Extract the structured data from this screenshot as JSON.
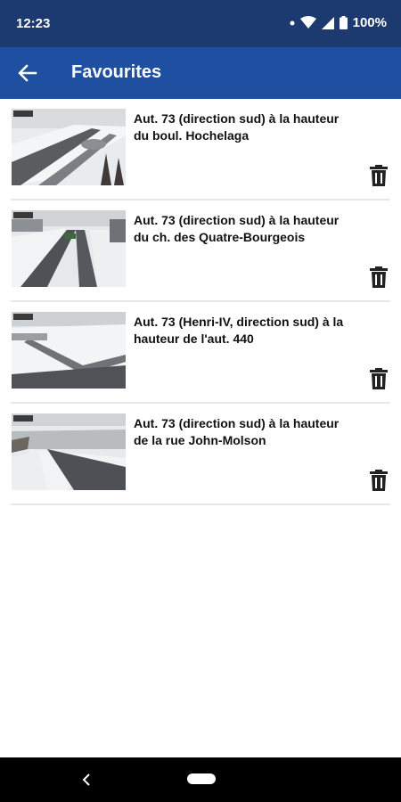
{
  "status": {
    "time": "12:23",
    "battery": "100%",
    "icons": [
      "dot-icon",
      "wifi-icon",
      "signal-icon",
      "battery-icon"
    ]
  },
  "app_bar": {
    "title": "Favourites",
    "back_icon": "arrow-left-icon"
  },
  "favourites": [
    {
      "title": "Aut. 73 (direction sud) à la hauteur du boul. Hochelaga",
      "action_icon": "trash-icon"
    },
    {
      "title": "Aut. 73 (direction sud) à la hauteur du ch. des Quatre-Bourgeois",
      "action_icon": "trash-icon"
    },
    {
      "title": "Aut. 73 (Henri-IV, direction sud) à la hauteur de l'aut. 440",
      "action_icon": "trash-icon"
    },
    {
      "title": "Aut. 73 (direction sud) à la hauteur de la rue John-Molson",
      "action_icon": "trash-icon"
    }
  ],
  "colors": {
    "status_bar": "#1d3a70",
    "app_bar": "#1f4fa0",
    "nav_bar": "#000000"
  }
}
